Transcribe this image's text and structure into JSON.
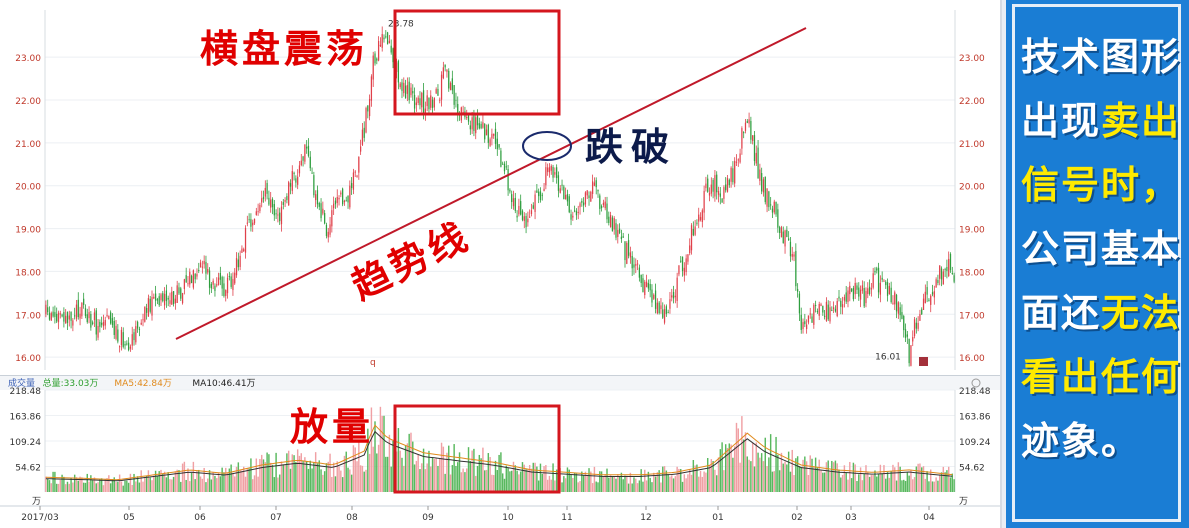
{
  "chart_data": {
    "type": "candlestick",
    "price_axis": {
      "ticks": [
        "16.00",
        "17.00",
        "18.00",
        "19.00",
        "20.00",
        "21.00",
        "22.00",
        "23.00"
      ],
      "ylim": [
        15.7,
        24.1
      ]
    },
    "volume_axis": {
      "ticks": [
        "218.48",
        "163.86",
        "109.24",
        "54.62",
        "万"
      ],
      "ylim": [
        0,
        218.48
      ]
    },
    "x_ticks": [
      "2017/03",
      "05",
      "06",
      "07",
      "08",
      "09",
      "10",
      "11",
      "12",
      "01",
      "02",
      "03",
      "04"
    ],
    "high_marker": "23.78",
    "low_marker": "16.01",
    "axis_marker": "q",
    "close_path": [
      [
        0,
        17.0
      ],
      [
        8,
        16.9
      ],
      [
        14,
        16.8
      ],
      [
        20,
        17.2
      ],
      [
        24,
        16.9
      ],
      [
        30,
        16.7
      ],
      [
        36,
        16.8
      ],
      [
        40,
        16.5
      ],
      [
        46,
        16.4
      ],
      [
        52,
        16.8
      ],
      [
        58,
        17.2
      ],
      [
        64,
        17.5
      ],
      [
        72,
        17.4
      ],
      [
        80,
        17.9
      ],
      [
        86,
        18.2
      ],
      [
        92,
        17.8
      ],
      [
        98,
        17.6
      ],
      [
        104,
        17.9
      ],
      [
        110,
        18.7
      ],
      [
        116,
        19.3
      ],
      [
        122,
        19.8
      ],
      [
        128,
        19.2
      ],
      [
        134,
        19.8
      ],
      [
        140,
        20.4
      ],
      [
        144,
        20.8
      ],
      [
        150,
        19.8
      ],
      [
        156,
        19.0
      ],
      [
        162,
        19.5
      ],
      [
        168,
        19.8
      ],
      [
        174,
        20.6
      ],
      [
        178,
        21.6
      ],
      [
        182,
        22.8
      ],
      [
        188,
        23.5
      ],
      [
        192,
        23.2
      ],
      [
        196,
        22.6
      ],
      [
        200,
        22.2
      ],
      [
        206,
        22.0
      ],
      [
        212,
        21.9
      ],
      [
        218,
        22.1
      ],
      [
        222,
        22.7
      ],
      [
        226,
        22.0
      ],
      [
        232,
        21.6
      ],
      [
        238,
        21.5
      ],
      [
        244,
        21.3
      ],
      [
        250,
        21.0
      ],
      [
        256,
        20.2
      ],
      [
        262,
        19.5
      ],
      [
        268,
        19.2
      ],
      [
        274,
        19.8
      ],
      [
        280,
        20.4
      ],
      [
        286,
        20.0
      ],
      [
        292,
        19.4
      ],
      [
        298,
        19.6
      ],
      [
        304,
        19.9
      ],
      [
        310,
        19.5
      ],
      [
        316,
        19.0
      ],
      [
        322,
        18.5
      ],
      [
        328,
        18.1
      ],
      [
        334,
        17.6
      ],
      [
        340,
        17.2
      ],
      [
        346,
        17.0
      ],
      [
        352,
        17.9
      ],
      [
        358,
        18.7
      ],
      [
        364,
        19.5
      ],
      [
        370,
        20.1
      ],
      [
        376,
        19.8
      ],
      [
        382,
        20.3
      ],
      [
        386,
        21.0
      ],
      [
        390,
        21.5
      ],
      [
        394,
        20.8
      ],
      [
        398,
        20.0
      ],
      [
        404,
        19.5
      ],
      [
        410,
        18.9
      ],
      [
        416,
        18.2
      ],
      [
        420,
        16.8
      ],
      [
        426,
        17.0
      ],
      [
        432,
        17.2
      ],
      [
        438,
        17.0
      ],
      [
        444,
        17.3
      ],
      [
        450,
        17.6
      ],
      [
        456,
        17.4
      ],
      [
        460,
        17.9
      ],
      [
        466,
        17.6
      ],
      [
        472,
        17.3
      ],
      [
        476,
        16.8
      ],
      [
        480,
        16.1
      ],
      [
        484,
        16.9
      ],
      [
        490,
        17.4
      ],
      [
        496,
        17.9
      ],
      [
        500,
        18.2
      ],
      [
        505,
        17.9
      ]
    ],
    "volume_path": [
      [
        0,
        30
      ],
      [
        20,
        28
      ],
      [
        40,
        25
      ],
      [
        60,
        35
      ],
      [
        80,
        45
      ],
      [
        100,
        38
      ],
      [
        120,
        55
      ],
      [
        140,
        65
      ],
      [
        160,
        55
      ],
      [
        178,
        85
      ],
      [
        182,
        140
      ],
      [
        190,
        110
      ],
      [
        200,
        95
      ],
      [
        210,
        80
      ],
      [
        230,
        70
      ],
      [
        250,
        60
      ],
      [
        270,
        45
      ],
      [
        290,
        40
      ],
      [
        310,
        35
      ],
      [
        330,
        35
      ],
      [
        350,
        40
      ],
      [
        370,
        55
      ],
      [
        390,
        120
      ],
      [
        400,
        90
      ],
      [
        420,
        55
      ],
      [
        440,
        45
      ],
      [
        460,
        40
      ],
      [
        480,
        45
      ],
      [
        505,
        35
      ]
    ],
    "legend": [
      {
        "label": "成交量",
        "color": "#3a5fb5"
      },
      {
        "label": "总量:33.03万",
        "color": "#2e9e2e"
      },
      {
        "label": "MA5:42.84万",
        "color": "#e08a1c"
      },
      {
        "label": "MA10:46.41万",
        "color": "#222222"
      }
    ],
    "annotations": {
      "consolidation": "横盘震荡",
      "breakdown": "跌破",
      "trendline": "趋势线",
      "volume": "放量"
    },
    "colors": {
      "up": "#e0404a",
      "down": "#2e9e3e",
      "trend": "#c0192a",
      "annot": "#e00000",
      "breakdown": "#0c1a4a",
      "box": "#d4161e"
    }
  },
  "side_panel": {
    "lines": [
      [
        {
          "text": "技术图形",
          "hl": false
        }
      ],
      [
        {
          "text": "出现",
          "hl": false
        },
        {
          "text": "卖出",
          "hl": true
        }
      ],
      [
        {
          "text": "信号时，",
          "hl": true
        }
      ],
      [
        {
          "text": "公司基本",
          "hl": false
        }
      ],
      [
        {
          "text": "面还",
          "hl": false
        },
        {
          "text": "无法",
          "hl": true
        }
      ],
      [
        {
          "text": "看出任何",
          "hl": true
        }
      ],
      [
        {
          "text": "迹象。",
          "hl": false
        }
      ]
    ]
  }
}
